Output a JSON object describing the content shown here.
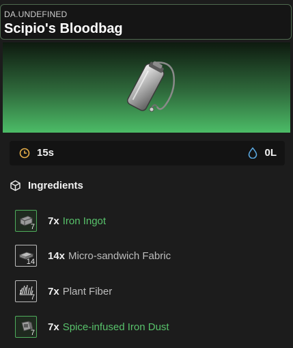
{
  "header": {
    "subtitle": "DA.UNDEFINED",
    "title": "Scipio's Bloodbag"
  },
  "item_icon": "bloodbag-icon",
  "stats": {
    "time": {
      "icon": "clock-icon",
      "value": "15s"
    },
    "water": {
      "icon": "water-drop-icon",
      "value": "0L"
    }
  },
  "ingredients": {
    "label": "Ingredients",
    "icon": "box-icon",
    "items": [
      {
        "qty": "7x",
        "name": "Iron Ingot",
        "count": "7",
        "icon": "iron-ingot-icon",
        "highlight": true
      },
      {
        "qty": "14x",
        "name": "Micro-sandwich Fabric",
        "count": "14",
        "icon": "fabric-icon",
        "highlight": false
      },
      {
        "qty": "7x",
        "name": "Plant Fiber",
        "count": "7",
        "icon": "plant-fiber-icon",
        "highlight": false
      },
      {
        "qty": "7x",
        "name": "Spice-infused Iron Dust",
        "count": "7",
        "icon": "iron-dust-icon",
        "highlight": true
      }
    ]
  },
  "colors": {
    "accent_green": "#58c26b",
    "clock": "#e8b04a",
    "water": "#5aa8e0"
  }
}
